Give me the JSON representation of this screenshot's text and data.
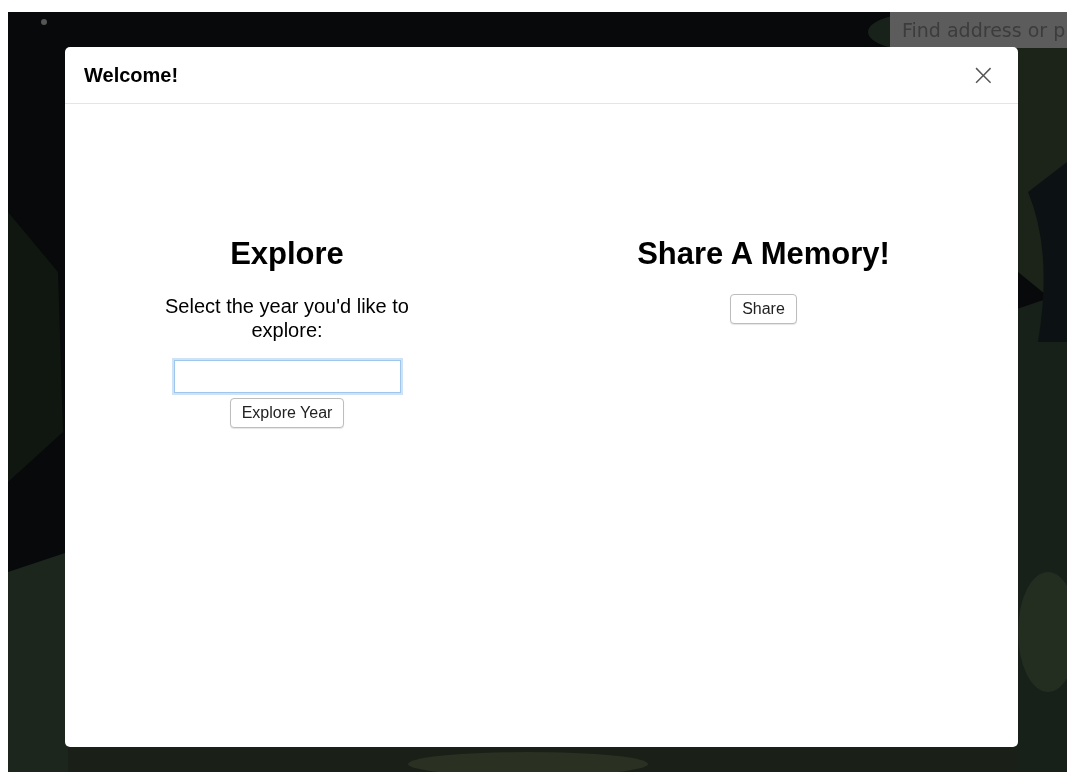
{
  "map": {
    "kind": "picture",
    "search": {
      "placeholder": "Find address or p"
    }
  },
  "dialog": {
    "title": "Welcome!",
    "close": "×",
    "explore": {
      "heading": "Explore",
      "prompt": "Select the year you'd like to explore:",
      "year_field": {
        "focused": true
      },
      "button": "Explore Year"
    },
    "share": {
      "heading": "Share A Memory!",
      "button": "Share"
    }
  }
}
